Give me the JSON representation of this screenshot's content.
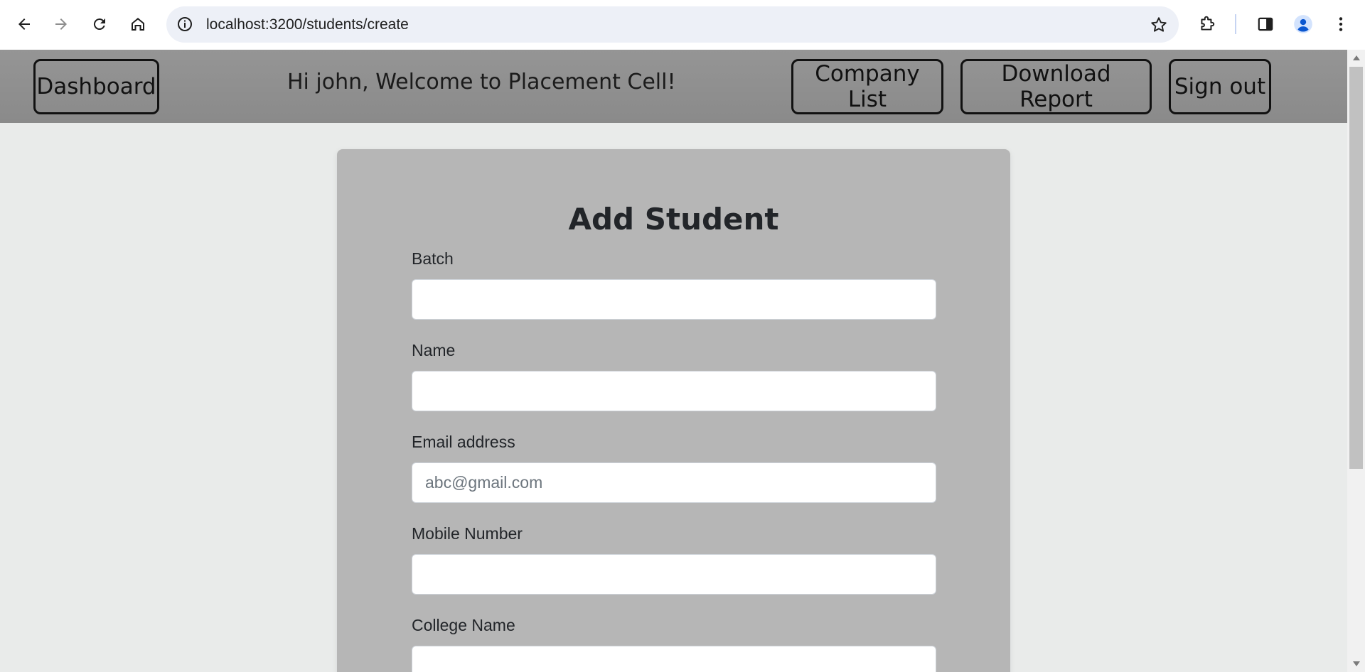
{
  "browser": {
    "url": "localhost:3200/students/create",
    "icons": [
      "back-arrow-icon",
      "forward-arrow-icon",
      "reload-icon",
      "home-icon",
      "site-info-icon",
      "bookmark-star-icon",
      "extensions-icon",
      "side-panel-icon",
      "profile-avatar-icon",
      "menu-kebab-icon"
    ]
  },
  "header": {
    "dashboard_label": "Dashboard",
    "welcome_text": "Hi john, Welcome to Placement Cell!",
    "company_list_label": "Company List",
    "download_report_label": "Download Report",
    "sign_out_label": "Sign out"
  },
  "form": {
    "title": "Add Student",
    "fields": [
      {
        "label": "Batch",
        "value": "",
        "placeholder": ""
      },
      {
        "label": "Name",
        "value": "",
        "placeholder": ""
      },
      {
        "label": "Email address",
        "value": "",
        "placeholder": "abc@gmail.com"
      },
      {
        "label": "Mobile Number",
        "value": "",
        "placeholder": ""
      },
      {
        "label": "College Name",
        "value": "",
        "placeholder": ""
      }
    ]
  },
  "colors": {
    "header_bg": "#8f8f8f",
    "card_bg": "#b6b6b6",
    "page_bg": "#e9ebea",
    "omnibox_bg": "#edf0f7",
    "profile_accent": "#0b57d0"
  }
}
